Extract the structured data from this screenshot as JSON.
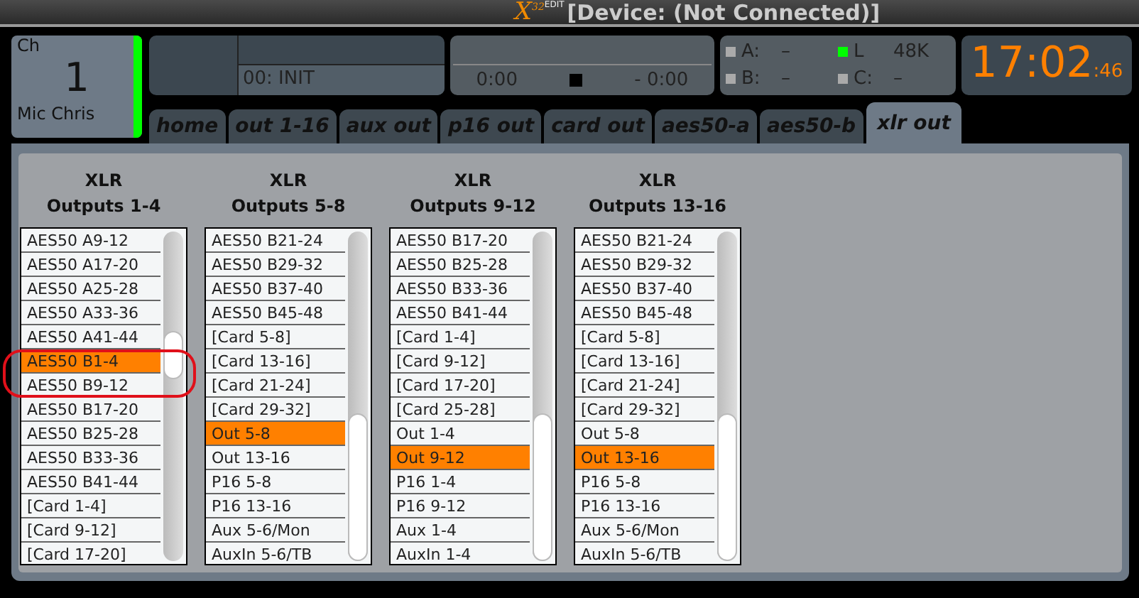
{
  "title_bar": {
    "logo": "X",
    "logo_sup": "32",
    "logo_edit": "EDIT",
    "title": "[Device: (Not Connected)]"
  },
  "channel": {
    "label": "Ch",
    "number": "1",
    "name": "Mic Chris"
  },
  "scene": {
    "name": "00: INIT"
  },
  "transport": {
    "elapsed": "0:00",
    "remaining": "- 0:00"
  },
  "status": [
    {
      "label": "A:",
      "value": "–",
      "on": false
    },
    {
      "label": "L",
      "value": "48K",
      "on": true
    },
    {
      "label": "B:",
      "value": "–",
      "on": false
    },
    {
      "label": "C:",
      "value": "–",
      "on": false
    }
  ],
  "clock": {
    "time": "17:02",
    "seconds": ":46"
  },
  "tabs": [
    {
      "label": "home",
      "selected": false
    },
    {
      "label": "out 1-16",
      "selected": false
    },
    {
      "label": "aux out",
      "selected": false
    },
    {
      "label": "p16 out",
      "selected": false
    },
    {
      "label": "card out",
      "selected": false
    },
    {
      "label": "aes50-a",
      "selected": false
    },
    {
      "label": "aes50-b",
      "selected": false
    },
    {
      "label": "xlr out",
      "selected": true
    }
  ],
  "outputs": [
    {
      "title": "XLR",
      "subtitle": "Outputs 1-4",
      "items": [
        {
          "label": "AES50 A9-12",
          "selected": false
        },
        {
          "label": "AES50 A17-20",
          "selected": false
        },
        {
          "label": "AES50 A25-28",
          "selected": false
        },
        {
          "label": "AES50 A33-36",
          "selected": false
        },
        {
          "label": "AES50 A41-44",
          "selected": false
        },
        {
          "label": "AES50 B1-4",
          "selected": true
        },
        {
          "label": "AES50 B9-12",
          "selected": false
        },
        {
          "label": "AES50 B17-20",
          "selected": false
        },
        {
          "label": "AES50 B25-28",
          "selected": false
        },
        {
          "label": "AES50 B33-36",
          "selected": false
        },
        {
          "label": "AES50 B41-44",
          "selected": false
        },
        {
          "label": "[Card 1-4]",
          "selected": false
        },
        {
          "label": "[Card 9-12]",
          "selected": false
        },
        {
          "label": "[Card 17-20]",
          "selected": false
        }
      ]
    },
    {
      "title": "XLR",
      "subtitle": "Outputs 5-8",
      "items": [
        {
          "label": "AES50 B21-24",
          "selected": false
        },
        {
          "label": "AES50 B29-32",
          "selected": false
        },
        {
          "label": "AES50 B37-40",
          "selected": false
        },
        {
          "label": "AES50 B45-48",
          "selected": false
        },
        {
          "label": "[Card 5-8]",
          "selected": false
        },
        {
          "label": "[Card 13-16]",
          "selected": false
        },
        {
          "label": "[Card 21-24]",
          "selected": false
        },
        {
          "label": "[Card 29-32]",
          "selected": false
        },
        {
          "label": "Out 5-8",
          "selected": true
        },
        {
          "label": "Out 13-16",
          "selected": false
        },
        {
          "label": "P16 5-8",
          "selected": false
        },
        {
          "label": "P16 13-16",
          "selected": false
        },
        {
          "label": "Aux 5-6/Mon",
          "selected": false
        },
        {
          "label": "AuxIn 5-6/TB",
          "selected": false
        }
      ]
    },
    {
      "title": "XLR",
      "subtitle": "Outputs 9-12",
      "items": [
        {
          "label": "AES50 B17-20",
          "selected": false
        },
        {
          "label": "AES50 B25-28",
          "selected": false
        },
        {
          "label": "AES50 B33-36",
          "selected": false
        },
        {
          "label": "AES50 B41-44",
          "selected": false
        },
        {
          "label": "[Card 1-4]",
          "selected": false
        },
        {
          "label": "[Card 9-12]",
          "selected": false
        },
        {
          "label": "[Card 17-20]",
          "selected": false
        },
        {
          "label": "[Card 25-28]",
          "selected": false
        },
        {
          "label": "Out 1-4",
          "selected": false
        },
        {
          "label": "Out 9-12",
          "selected": true
        },
        {
          "label": "P16 1-4",
          "selected": false
        },
        {
          "label": "P16 9-12",
          "selected": false
        },
        {
          "label": "Aux 1-4",
          "selected": false
        },
        {
          "label": "AuxIn 1-4",
          "selected": false
        }
      ]
    },
    {
      "title": "XLR",
      "subtitle": "Outputs 13-16",
      "items": [
        {
          "label": "AES50 B21-24",
          "selected": false
        },
        {
          "label": "AES50 B29-32",
          "selected": false
        },
        {
          "label": "AES50 B37-40",
          "selected": false
        },
        {
          "label": "AES50 B45-48",
          "selected": false
        },
        {
          "label": "[Card 5-8]",
          "selected": false
        },
        {
          "label": "[Card 13-16]",
          "selected": false
        },
        {
          "label": "[Card 21-24]",
          "selected": false
        },
        {
          "label": "[Card 29-32]",
          "selected": false
        },
        {
          "label": "Out 5-8",
          "selected": false
        },
        {
          "label": "Out 13-16",
          "selected": true
        },
        {
          "label": "P16 5-8",
          "selected": false
        },
        {
          "label": "P16 13-16",
          "selected": false
        },
        {
          "label": "Aux 5-6/Mon",
          "selected": false
        },
        {
          "label": "AuxIn 5-6/TB",
          "selected": false
        }
      ]
    }
  ]
}
